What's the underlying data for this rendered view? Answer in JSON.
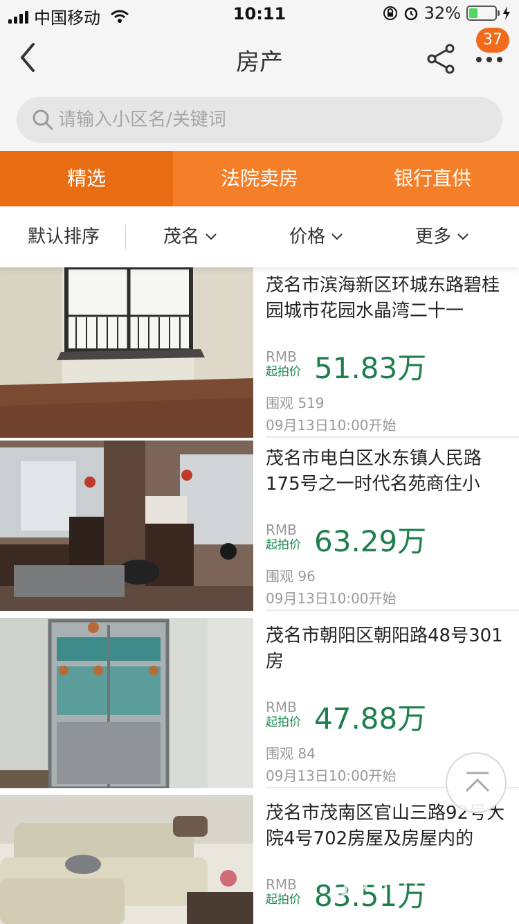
{
  "status_bar": {
    "carrier": "中国移动",
    "time": "10:11",
    "battery_percent": "32%",
    "battery_level": 0.32
  },
  "nav": {
    "title": "房产",
    "badge_count": "37"
  },
  "search": {
    "placeholder": "请输入小区名/关键词"
  },
  "tabs": [
    {
      "label": "精选",
      "active": true
    },
    {
      "label": "法院卖房",
      "active": false
    },
    {
      "label": "银行直供",
      "active": false
    }
  ],
  "filters": {
    "sort": "默认排序",
    "city": "茂名",
    "price": "价格",
    "more": "更多"
  },
  "listings": [
    {
      "title": "茂名市滨海新区环城东路碧桂园城市花园水晶湾二十一",
      "currency": "RMB",
      "price_label": "起拍价",
      "price": "51.83万",
      "views": "围观 519",
      "start": "09月13日10:00开始"
    },
    {
      "title": "茂名市电白区水东镇人民路175号之一时代名苑商住小",
      "currency": "RMB",
      "price_label": "起拍价",
      "price": "63.29万",
      "views": "围观 96",
      "start": "09月13日10:00开始"
    },
    {
      "title": "茂名市朝阳区朝阳路48号301房",
      "currency": "RMB",
      "price_label": "起拍价",
      "price": "47.88万",
      "views": "围观 84",
      "start": "09月13日10:00开始"
    },
    {
      "title": "茂名市茂南区官山三路92号大院4号702房屋及房屋内的",
      "currency": "RMB",
      "price_label": "起拍价",
      "price": "83.51万"
    }
  ],
  "watermark": "gdmm.com",
  "colors": {
    "tab_bg": "#f47f28",
    "tab_active": "#e96d12",
    "price_green": "#1e7f4d",
    "badge": "#f26b1d"
  }
}
